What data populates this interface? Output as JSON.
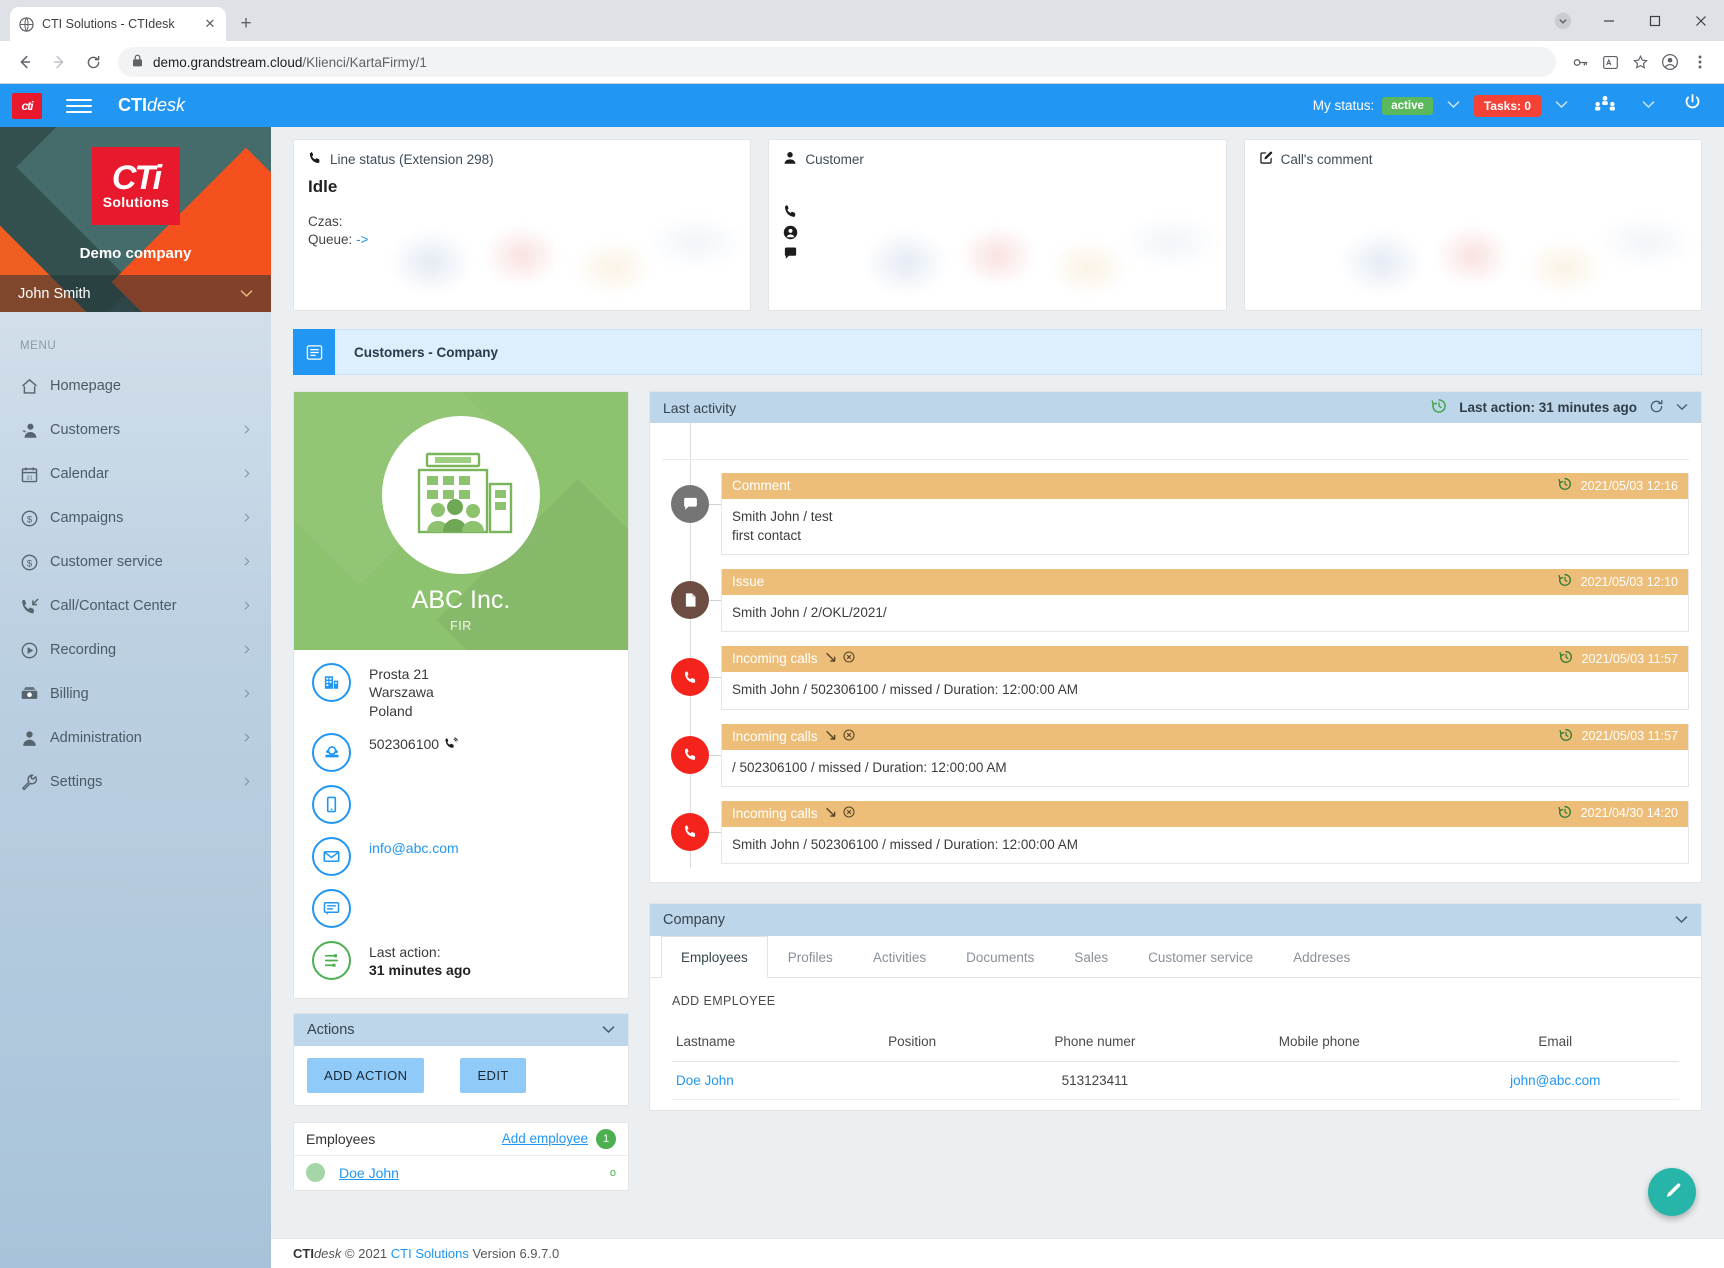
{
  "browser": {
    "tab": {
      "title": "CTI Solutions - CTIdesk",
      "favicon": "globe-icon",
      "close": "✕"
    },
    "newtab_label": "+",
    "window": {
      "minimize": "─",
      "maximize": "☐",
      "close": "✕",
      "dropdown": "⌄"
    },
    "nav": {
      "back": "←",
      "forward": "→",
      "reload": "↻"
    },
    "url": {
      "lock": "ὑ2",
      "host": "demo.grandstream.cloud",
      "path": "/Klienci/KartaFirmy/1",
      "full": "demo.grandstream.cloud/Klienci/KartaFirmy/1"
    },
    "omni_icons": [
      "key-icon",
      "translate-icon",
      "bookmark-star-icon",
      "profile-icon",
      "menu-kebab-icon"
    ]
  },
  "topbar": {
    "logo_text": "cti",
    "brand_bold": "CTI",
    "brand_italic": "desk",
    "my_status_label": "My status:",
    "status_value": "active",
    "tasks_label": "Tasks: 0",
    "users_icon": "people-group-icon",
    "power_icon": "power-icon",
    "accent": "#2196f3",
    "status_color": "#5cb85c",
    "tasks_color": "#f44336"
  },
  "sidebar": {
    "logo_line1": "CTi",
    "logo_line2": "Solutions",
    "company": "Demo company",
    "user": "John Smith",
    "menu_label": "MENU",
    "items": [
      {
        "label": "Homepage",
        "icon": "home-icon",
        "glyph": "⌂",
        "chevron": false
      },
      {
        "label": "Customers",
        "icon": "user-customers-icon",
        "glyph": "👤",
        "chevron": true
      },
      {
        "label": "Calendar",
        "icon": "calendar-icon",
        "glyph": "🗓",
        "chevron": true
      },
      {
        "label": "Campaigns",
        "icon": "dollar-circle-icon",
        "glyph": "Ⓢ",
        "chevron": true
      },
      {
        "label": "Customer service",
        "icon": "dollar-circle-icon",
        "glyph": "Ⓢ",
        "chevron": true
      },
      {
        "label": "Call/Contact Center",
        "icon": "phone-incoming-icon",
        "glyph": "📞",
        "chevron": true
      },
      {
        "label": "Recording",
        "icon": "play-circle-icon",
        "glyph": "▶",
        "chevron": true
      },
      {
        "label": "Billing",
        "icon": "money-icon",
        "glyph": "💵",
        "chevron": true
      },
      {
        "label": "Administration",
        "icon": "user-admin-icon",
        "glyph": "👤",
        "chevron": true
      },
      {
        "label": "Settings",
        "icon": "wrench-icon",
        "glyph": "🔧",
        "chevron": true
      }
    ]
  },
  "cards": {
    "line_status": {
      "icon": "phone-icon",
      "title": "Line status (Extension 298)",
      "state": "Idle",
      "time_label": "Czas:",
      "queue_label": "Queue:",
      "queue_value": "->"
    },
    "customer": {
      "icon": "person-icon",
      "title": "Customer",
      "action_icons": [
        "phone-icon",
        "person-circle-icon",
        "comment-icon"
      ]
    },
    "call_comment": {
      "icon": "pencil-square-icon",
      "title": "Call's comment"
    }
  },
  "breadcrumb": {
    "icon": "card-list-icon",
    "label": "Customers - Company"
  },
  "company_card": {
    "name": "ABC Inc.",
    "subtitle": "FIR",
    "avatar_icon": "building-people-icon",
    "rows": [
      {
        "icon": "building-icon",
        "lines": [
          "Prosta 21",
          "Warszawa",
          "Poland"
        ],
        "type": "address"
      },
      {
        "icon": "telephone-icon",
        "lines": [
          "502306100"
        ],
        "type": "phone",
        "dial_icon": "phone-call-icon"
      },
      {
        "icon": "mobile-icon",
        "lines": [
          ""
        ],
        "type": "mobile"
      },
      {
        "icon": "envelope-icon",
        "lines": [
          "info@abc.com"
        ],
        "type": "email"
      },
      {
        "icon": "comment-box-icon",
        "lines": [
          ""
        ],
        "type": "comment"
      },
      {
        "icon": "activity-list-icon",
        "lines": [
          "Last action:",
          "31 minutes ago"
        ],
        "type": "lastaction"
      }
    ]
  },
  "actions_panel": {
    "title": "Actions",
    "chevron": "⌄",
    "add_action_label": "ADD ACTION",
    "edit_label": "EDIT"
  },
  "employees_panel": {
    "title": "Employees",
    "add_employee_label": "Add employee",
    "count": "1",
    "rows": [
      {
        "name": "Doe John",
        "status": "o"
      }
    ]
  },
  "last_activity": {
    "title": "Last activity",
    "last_action_text": "Last action: 31 minutes ago",
    "clock_icon": "clock-history-icon",
    "refresh_icon": "refresh-icon",
    "chevron": "⌄",
    "items": [
      {
        "type": "Comment",
        "bullet_icon": "comment-icon",
        "bullet_glyph": "💬",
        "bullet_color": "#757575",
        "timestamp": "2021/05/03 12:16",
        "body_lines": [
          "Smith John / test",
          "first contact"
        ],
        "head_icons": []
      },
      {
        "type": "Issue",
        "bullet_icon": "document-icon",
        "bullet_glyph": "🗋",
        "bullet_color": "#6d4c41",
        "timestamp": "2021/05/03 12:10",
        "body_lines": [
          "Smith John / 2/OKL/2021/"
        ],
        "head_icons": []
      },
      {
        "type": "Incoming calls",
        "bullet_icon": "phone-missed-icon",
        "bullet_glyph": "📞",
        "bullet_color": "#f4231c",
        "timestamp": "2021/05/03 11:57",
        "body_lines": [
          "Smith John / 502306100 / missed / Duration: 12:00:00 AM"
        ],
        "head_icons": [
          "arrow-down-right-icon",
          "circle-x-icon"
        ]
      },
      {
        "type": "Incoming calls",
        "bullet_icon": "phone-missed-icon",
        "bullet_glyph": "📞",
        "bullet_color": "#f4231c",
        "timestamp": "2021/05/03 11:57",
        "body_lines": [
          "/ 502306100 / missed / Duration: 12:00:00 AM"
        ],
        "head_icons": [
          "arrow-down-right-icon",
          "circle-x-icon"
        ]
      },
      {
        "type": "Incoming calls",
        "bullet_icon": "phone-missed-icon",
        "bullet_glyph": "📞",
        "bullet_color": "#f4231c",
        "timestamp": "2021/04/30 14:20",
        "body_lines": [
          "Smith John / 502306100 / missed / Duration: 12:00:00 AM"
        ],
        "head_icons": [
          "arrow-down-right-icon",
          "circle-x-icon"
        ]
      }
    ]
  },
  "company_panel": {
    "title": "Company",
    "chevron": "⌄",
    "tabs": [
      {
        "label": "Employees",
        "active": true
      },
      {
        "label": "Profiles",
        "active": false
      },
      {
        "label": "Activities",
        "active": false
      },
      {
        "label": "Documents",
        "active": false
      },
      {
        "label": "Sales",
        "active": false
      },
      {
        "label": "Customer service",
        "active": false
      },
      {
        "label": "Addreses",
        "active": false
      }
    ],
    "add_employee_button": "ADD EMPLOYEE",
    "table": {
      "columns": [
        "Lastname",
        "Position",
        "Phone numer",
        "Mobile phone",
        "Email"
      ],
      "rows": [
        {
          "lastname": "Doe John",
          "position": "",
          "phone": "513123411",
          "mobile": "",
          "email": "john@abc.com"
        }
      ]
    }
  },
  "fab": {
    "icon": "pencil-icon",
    "glyph": "✎",
    "color": "#26b5a8"
  },
  "footer": {
    "brand_bold": "CTI",
    "brand_italic": "desk",
    "copyright": "© 2021",
    "company_link": "CTI Solutions",
    "version": "Version 6.9.7.0"
  }
}
